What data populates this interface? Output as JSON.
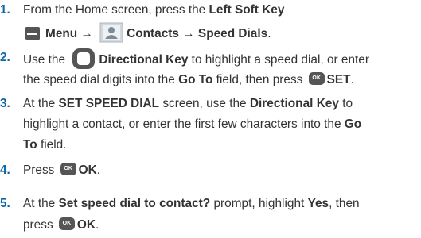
{
  "colors": {
    "accent": "#0f66a7",
    "text": "#333333",
    "key": "#555555"
  },
  "steps": [
    {
      "num": "1.",
      "a": "From the Home screen, press the ",
      "b": "Left Soft Key",
      "c": "Menu → ",
      "d": "Contacts → Speed Dials",
      "e": ".",
      "icons": [
        "left-soft-key-icon",
        "contacts-icon"
      ]
    },
    {
      "num": "2.",
      "a": "Use the ",
      "b": "Directional Key",
      "c": " to highlight a speed dial, or enter",
      "d": "the speed dial digits into the ",
      "e": "Go To",
      "f": " field, then press ",
      "g": "SET",
      "h": ".",
      "icons": [
        "directional-key-icon",
        "ok-key-icon"
      ]
    },
    {
      "num": "3.",
      "a": "At the ",
      "b": "SET SPEED DIAL",
      "c": " screen, use the ",
      "d": "Directional Key",
      "e": " to",
      "f": "highlight a contact, or enter the first few characters into the ",
      "g": "Go",
      "h": "To",
      "i": " field."
    },
    {
      "num": "4.",
      "a": "Press ",
      "b": "OK",
      "c": ".",
      "icons": [
        "ok-key-icon"
      ]
    },
    {
      "num": "5.",
      "a": "At the ",
      "b": "Set speed dial to contact?",
      "c": " prompt, highlight ",
      "d": "Yes",
      "e": ", then",
      "f": "press ",
      "g": "OK",
      "h": ".",
      "icons": [
        "ok-key-icon"
      ]
    }
  ]
}
